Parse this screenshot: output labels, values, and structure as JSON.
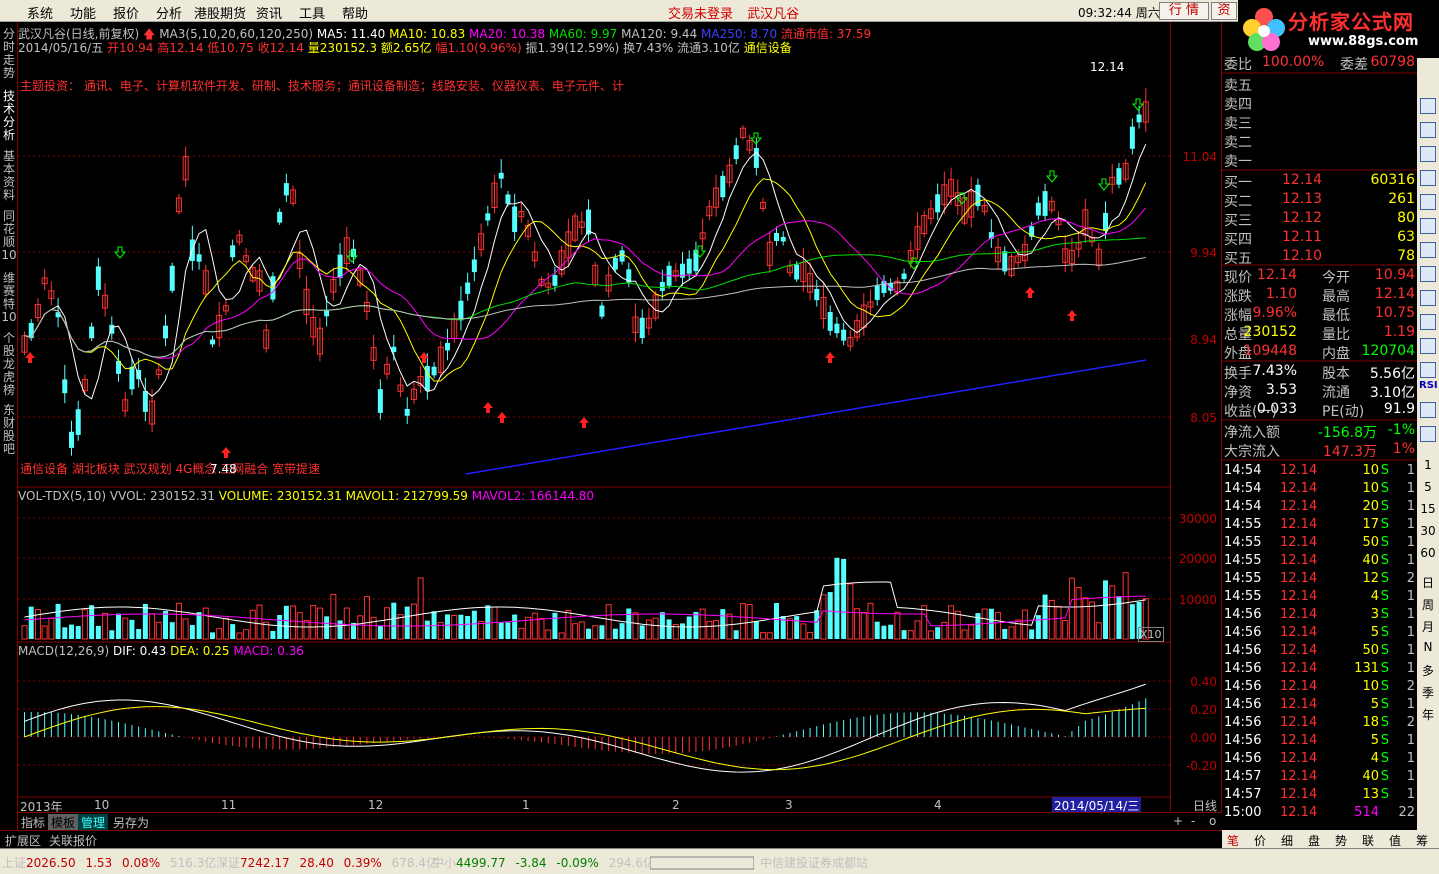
{
  "menu": [
    "系统",
    "功能",
    "报价",
    "分析",
    "港股期货",
    "资讯",
    "工具",
    "帮助"
  ],
  "top_status": [
    "交易未登录",
    "武汉凡谷"
  ],
  "clock": "09:32:44 周六",
  "top_buttons": [
    "行 情",
    "资"
  ],
  "logo": {
    "name": "分析家公式网",
    "url": "www.88gs.com"
  },
  "left_tabs": [
    "分时走势",
    "技术分析",
    "基本资料",
    "同花顺10",
    "维赛特10",
    "个股龙虎榜",
    "东财股吧"
  ],
  "header": {
    "line1": {
      "title": "武汉凡谷(日线,前复权)",
      "ma": "MA3(5,10,20,60,120,250)",
      "ma5": "MA5: 11.40",
      "ma10": "MA10: 10.83",
      "ma20": "MA20: 10.38",
      "ma60": "MA60: 9.97",
      "ma120": "MA120: 9.44",
      "ma250": "MA250: 8.70",
      "cap": "流通市值: 37.59"
    },
    "line2": {
      "date": "2014/05/16/五",
      "open": "开10.94",
      "high": "高12.14",
      "low": "低10.75",
      "close": "收12.14",
      "vol": "量230152.3",
      "amt": "额2.65亿",
      "chg": "幅1.10(9.96%)",
      "amp": "振1.39(12.59%)",
      "turn": "换7.43%",
      "float": "流通3.10亿",
      "sector": "通信设备"
    },
    "theme": "主题投资：     通讯、电子、计算机软件开发、研制、技术服务；通讯设备制造；线路安装、仪器仪表、电子元件、计",
    "tags": "通信设备 湖北板块 武汉规划 4G概念 三网融合 宽带提速",
    "high_label": "12.14",
    "low_label": "7.48"
  },
  "vol_header": {
    "name": "VOL-TDX(5,10)",
    "vvol": "VVOL: 230152.31",
    "volume": "VOLUME: 230152.31",
    "mavol1": "MAVOL1: 212799.59",
    "mavol2": "MAVOL2: 166144.80"
  },
  "macd_header": {
    "name": "MACD(12,26,9)",
    "dif": "DIF: 0.43",
    "dea": "DEA: 0.25",
    "macd": "MACD: 0.36"
  },
  "price_axis": [
    "11.04",
    "9.94",
    "8.94",
    "8.05"
  ],
  "vol_axis": [
    "30000",
    "20000",
    "10000"
  ],
  "vol_unit": "X10",
  "macd_axis": [
    "0.40",
    "0.20",
    "0.00",
    "-0.20"
  ],
  "date_axis": [
    "2013年",
    "10",
    "11",
    "12",
    "1",
    "2",
    "3",
    "4"
  ],
  "date_highlight": "2014/05/14/三",
  "period": "日线",
  "bottom_tabs": [
    "指标",
    "模板",
    "管理",
    "另存为"
  ],
  "ext_tabs": [
    "扩展区",
    "关联报价"
  ],
  "quote": {
    "webi": {
      "label": "委比",
      "value": "100.00%",
      "label2": "委差",
      "value2": "60798"
    },
    "sells": [
      "卖五",
      "卖四",
      "卖三",
      "卖二",
      "卖一"
    ],
    "buys": [
      {
        "label": "买一",
        "price": "12.14",
        "vol": "60316"
      },
      {
        "label": "买二",
        "price": "12.13",
        "vol": "261"
      },
      {
        "label": "买三",
        "price": "12.12",
        "vol": "80"
      },
      {
        "label": "买四",
        "price": "12.11",
        "vol": "63"
      },
      {
        "label": "买五",
        "price": "12.10",
        "vol": "78"
      }
    ],
    "stats": [
      {
        "l1": "现价",
        "v1": "12.14",
        "l2": "今开",
        "v2": "10.94"
      },
      {
        "l1": "涨跌",
        "v1": "1.10",
        "l2": "最高",
        "v2": "12.14"
      },
      {
        "l1": "涨幅",
        "v1": "9.96%",
        "l2": "最低",
        "v2": "10.75"
      },
      {
        "l1": "总量",
        "v1": "230152",
        "l2": "量比",
        "v2": "1.19"
      },
      {
        "l1": "外盘",
        "v1": "109448",
        "l2": "内盘",
        "v2": "120704"
      }
    ],
    "stats2": [
      {
        "l1": "换手",
        "v1": "7.43%",
        "l2": "股本",
        "v2": "5.56亿"
      },
      {
        "l1": "净资",
        "v1": "3.53",
        "l2": "流通",
        "v2": "3.10亿"
      },
      {
        "l1": "收益(一)",
        "v1": "0.033",
        "l2": "PE(动)",
        "v2": "91.9"
      }
    ],
    "flow": [
      {
        "label": "净流入额",
        "value": "-156.8万",
        "pct": "-1%"
      },
      {
        "label": "大宗流入",
        "value": "147.3万",
        "pct": "1%"
      }
    ],
    "ticks": [
      {
        "t": "14:54",
        "p": "12.14",
        "v": "10",
        "s": "S",
        "n": "1"
      },
      {
        "t": "14:54",
        "p": "12.14",
        "v": "10",
        "s": "S",
        "n": "1"
      },
      {
        "t": "14:54",
        "p": "12.14",
        "v": "20",
        "s": "S",
        "n": "1"
      },
      {
        "t": "14:55",
        "p": "12.14",
        "v": "17",
        "s": "S",
        "n": "1"
      },
      {
        "t": "14:55",
        "p": "12.14",
        "v": "50",
        "s": "S",
        "n": "1"
      },
      {
        "t": "14:55",
        "p": "12.14",
        "v": "40",
        "s": "S",
        "n": "1"
      },
      {
        "t": "14:55",
        "p": "12.14",
        "v": "12",
        "s": "S",
        "n": "2"
      },
      {
        "t": "14:55",
        "p": "12.14",
        "v": "4",
        "s": "S",
        "n": "1"
      },
      {
        "t": "14:56",
        "p": "12.14",
        "v": "3",
        "s": "S",
        "n": "1"
      },
      {
        "t": "14:56",
        "p": "12.14",
        "v": "5",
        "s": "S",
        "n": "1"
      },
      {
        "t": "14:56",
        "p": "12.14",
        "v": "50",
        "s": "S",
        "n": "1"
      },
      {
        "t": "14:56",
        "p": "12.14",
        "v": "131",
        "s": "S",
        "n": "1"
      },
      {
        "t": "14:56",
        "p": "12.14",
        "v": "10",
        "s": "S",
        "n": "2"
      },
      {
        "t": "14:56",
        "p": "12.14",
        "v": "5",
        "s": "S",
        "n": "1"
      },
      {
        "t": "14:56",
        "p": "12.14",
        "v": "18",
        "s": "S",
        "n": "2"
      },
      {
        "t": "14:56",
        "p": "12.14",
        "v": "5",
        "s": "S",
        "n": "1"
      },
      {
        "t": "14:56",
        "p": "12.14",
        "v": "4",
        "s": "S",
        "n": "1"
      },
      {
        "t": "14:57",
        "p": "12.14",
        "v": "40",
        "s": "S",
        "n": "1"
      },
      {
        "t": "14:57",
        "p": "12.14",
        "v": "13",
        "s": "S",
        "n": "1"
      },
      {
        "t": "15:00",
        "p": "12.14",
        "v": "514",
        "s": "",
        "n": "22"
      }
    ]
  },
  "qp_tabs": [
    "笔",
    "价",
    "细",
    "盘",
    "势",
    "联",
    "值",
    "筹"
  ],
  "right_tool_text": [
    "RSI",
    "1",
    "5",
    "15",
    "30",
    "60",
    "日",
    "周",
    "月",
    "N",
    "多",
    "季",
    "年"
  ],
  "status": {
    "sh": {
      "label": "上证",
      "val": "2026.50",
      "chg": "1.53",
      "pct": "0.08%",
      "amt": "516.3亿"
    },
    "sz": {
      "label": "深证",
      "val": "7242.17",
      "chg": "28.40",
      "pct": "0.39%",
      "amt": "678.4亿"
    },
    "zx": {
      "label": "中小",
      "val": "4499.77",
      "chg": "-3.84",
      "pct": "-0.09%",
      "amt": "294.6亿"
    },
    "broker": "中信建投证券成都站"
  },
  "colors": {
    "up": "#ff3232",
    "down": "#54ffff",
    "ma5": "#ffffff",
    "ma10": "#ffff00",
    "ma20": "#ff00ff",
    "ma60": "#00e000",
    "ma120": "#c0c0c0",
    "ma250": "#2020ff",
    "grid": "#800000"
  }
}
